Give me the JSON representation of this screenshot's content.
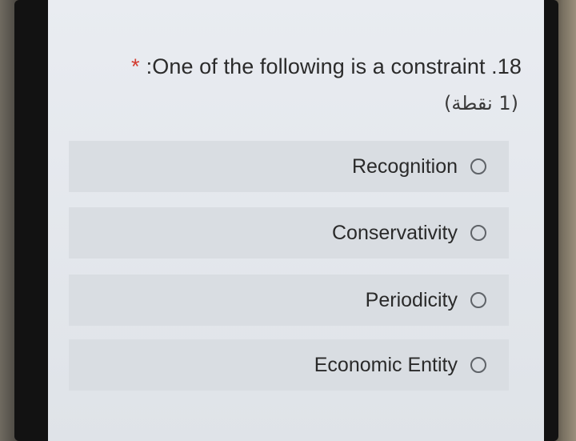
{
  "question": {
    "required_mark": "*",
    "text": ":One of the following is a constraint .18",
    "points": "(1 نقطة)"
  },
  "options": [
    {
      "label": "Recognition"
    },
    {
      "label": "Conservativity"
    },
    {
      "label": "Periodicity"
    },
    {
      "label": "Economic Entity"
    }
  ]
}
